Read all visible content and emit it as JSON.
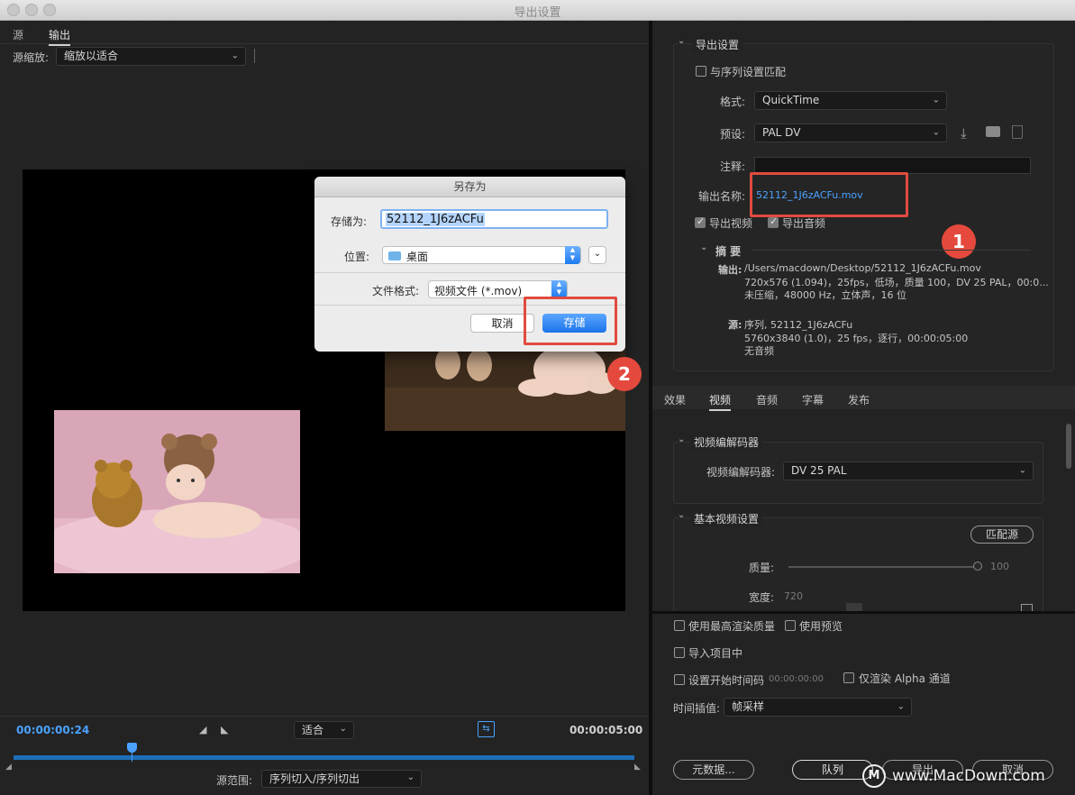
{
  "window": {
    "title": "导出设置"
  },
  "left": {
    "tabs": [
      "源",
      "输出"
    ],
    "source_scale_label": "源缩放:",
    "source_scale_value": "缩放以适合",
    "timecode_current": "00:00:00:24",
    "timecode_end": "00:00:05:00",
    "fit_value": "适合",
    "source_range_label": "源范围:",
    "source_range_value": "序列切入/序列切出"
  },
  "dialog": {
    "title": "另存为",
    "save_as_label": "存储为:",
    "save_as_value": "52112_1J6zACFu",
    "location_label": "位置:",
    "location_value": "桌面",
    "format_label": "文件格式:",
    "format_value": "视频文件 (*.mov)",
    "cancel": "取消",
    "save": "存储"
  },
  "export": {
    "section_title": "导出设置",
    "match_sequence": "与序列设置匹配",
    "format_label": "格式:",
    "format_value": "QuickTime",
    "preset_label": "预设:",
    "preset_value": "PAL DV",
    "comment_label": "注释:",
    "output_name_label": "输出名称:",
    "output_name_value": "52112_1J6zACFu.mov",
    "export_video": "导出视频",
    "export_audio": "导出音频",
    "summary_title": "摘 要",
    "summary_output_label": "输出:",
    "summary_output_lines": [
      "/Users/macdown/Desktop/52112_1J6zACFu.mov",
      "720x576 (1.094)，25fps，低场，质量 100，DV 25 PAL，00:0...",
      "未压缩，48000 Hz，立体声，16 位"
    ],
    "summary_source_label": "源:",
    "summary_source_lines": [
      "序列, 52112_1J6zACFu",
      "5760x3840 (1.0)，25 fps，逐行，00:00:05:00",
      "无音频"
    ]
  },
  "tabs2": [
    "效果",
    "视频",
    "音频",
    "字幕",
    "发布"
  ],
  "video": {
    "codec_section": "视频编解码器",
    "codec_label": "视频编解码器:",
    "codec_value": "DV 25 PAL",
    "basic_section": "基本视频设置",
    "match_source": "匹配源",
    "quality_label": "质量:",
    "quality_value": "100",
    "quality_fraction": 1.0,
    "width_label": "宽度:",
    "width_value": "720"
  },
  "bottom": {
    "max_render": "使用最高渲染质量",
    "use_preview": "使用预览",
    "import_project": "导入项目中",
    "set_start_tc": "设置开始时间码",
    "start_tc_value": "00:00:00:00",
    "alpha_only": "仅渲染 Alpha 通道",
    "time_interp_label": "时间插值:",
    "time_interp_value": "帧采样",
    "metadata": "元数据...",
    "queue": "队列",
    "export": "导出",
    "cancel": "取消"
  },
  "badges": [
    "1",
    "2"
  ],
  "watermark": "www.MacDown.com"
}
